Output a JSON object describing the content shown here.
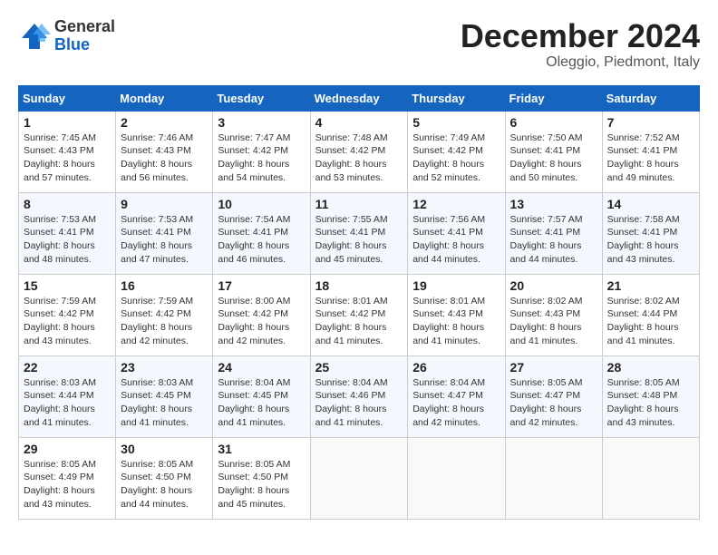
{
  "header": {
    "logo_general": "General",
    "logo_blue": "Blue",
    "title": "December 2024",
    "location": "Oleggio, Piedmont, Italy"
  },
  "days_of_week": [
    "Sunday",
    "Monday",
    "Tuesday",
    "Wednesday",
    "Thursday",
    "Friday",
    "Saturday"
  ],
  "weeks": [
    [
      {
        "day": 1,
        "info": "Sunrise: 7:45 AM\nSunset: 4:43 PM\nDaylight: 8 hours\nand 57 minutes."
      },
      {
        "day": 2,
        "info": "Sunrise: 7:46 AM\nSunset: 4:43 PM\nDaylight: 8 hours\nand 56 minutes."
      },
      {
        "day": 3,
        "info": "Sunrise: 7:47 AM\nSunset: 4:42 PM\nDaylight: 8 hours\nand 54 minutes."
      },
      {
        "day": 4,
        "info": "Sunrise: 7:48 AM\nSunset: 4:42 PM\nDaylight: 8 hours\nand 53 minutes."
      },
      {
        "day": 5,
        "info": "Sunrise: 7:49 AM\nSunset: 4:42 PM\nDaylight: 8 hours\nand 52 minutes."
      },
      {
        "day": 6,
        "info": "Sunrise: 7:50 AM\nSunset: 4:41 PM\nDaylight: 8 hours\nand 50 minutes."
      },
      {
        "day": 7,
        "info": "Sunrise: 7:52 AM\nSunset: 4:41 PM\nDaylight: 8 hours\nand 49 minutes."
      }
    ],
    [
      {
        "day": 8,
        "info": "Sunrise: 7:53 AM\nSunset: 4:41 PM\nDaylight: 8 hours\nand 48 minutes."
      },
      {
        "day": 9,
        "info": "Sunrise: 7:53 AM\nSunset: 4:41 PM\nDaylight: 8 hours\nand 47 minutes."
      },
      {
        "day": 10,
        "info": "Sunrise: 7:54 AM\nSunset: 4:41 PM\nDaylight: 8 hours\nand 46 minutes."
      },
      {
        "day": 11,
        "info": "Sunrise: 7:55 AM\nSunset: 4:41 PM\nDaylight: 8 hours\nand 45 minutes."
      },
      {
        "day": 12,
        "info": "Sunrise: 7:56 AM\nSunset: 4:41 PM\nDaylight: 8 hours\nand 44 minutes."
      },
      {
        "day": 13,
        "info": "Sunrise: 7:57 AM\nSunset: 4:41 PM\nDaylight: 8 hours\nand 44 minutes."
      },
      {
        "day": 14,
        "info": "Sunrise: 7:58 AM\nSunset: 4:41 PM\nDaylight: 8 hours\nand 43 minutes."
      }
    ],
    [
      {
        "day": 15,
        "info": "Sunrise: 7:59 AM\nSunset: 4:42 PM\nDaylight: 8 hours\nand 43 minutes."
      },
      {
        "day": 16,
        "info": "Sunrise: 7:59 AM\nSunset: 4:42 PM\nDaylight: 8 hours\nand 42 minutes."
      },
      {
        "day": 17,
        "info": "Sunrise: 8:00 AM\nSunset: 4:42 PM\nDaylight: 8 hours\nand 42 minutes."
      },
      {
        "day": 18,
        "info": "Sunrise: 8:01 AM\nSunset: 4:42 PM\nDaylight: 8 hours\nand 41 minutes."
      },
      {
        "day": 19,
        "info": "Sunrise: 8:01 AM\nSunset: 4:43 PM\nDaylight: 8 hours\nand 41 minutes."
      },
      {
        "day": 20,
        "info": "Sunrise: 8:02 AM\nSunset: 4:43 PM\nDaylight: 8 hours\nand 41 minutes."
      },
      {
        "day": 21,
        "info": "Sunrise: 8:02 AM\nSunset: 4:44 PM\nDaylight: 8 hours\nand 41 minutes."
      }
    ],
    [
      {
        "day": 22,
        "info": "Sunrise: 8:03 AM\nSunset: 4:44 PM\nDaylight: 8 hours\nand 41 minutes."
      },
      {
        "day": 23,
        "info": "Sunrise: 8:03 AM\nSunset: 4:45 PM\nDaylight: 8 hours\nand 41 minutes."
      },
      {
        "day": 24,
        "info": "Sunrise: 8:04 AM\nSunset: 4:45 PM\nDaylight: 8 hours\nand 41 minutes."
      },
      {
        "day": 25,
        "info": "Sunrise: 8:04 AM\nSunset: 4:46 PM\nDaylight: 8 hours\nand 41 minutes."
      },
      {
        "day": 26,
        "info": "Sunrise: 8:04 AM\nSunset: 4:47 PM\nDaylight: 8 hours\nand 42 minutes."
      },
      {
        "day": 27,
        "info": "Sunrise: 8:05 AM\nSunset: 4:47 PM\nDaylight: 8 hours\nand 42 minutes."
      },
      {
        "day": 28,
        "info": "Sunrise: 8:05 AM\nSunset: 4:48 PM\nDaylight: 8 hours\nand 43 minutes."
      }
    ],
    [
      {
        "day": 29,
        "info": "Sunrise: 8:05 AM\nSunset: 4:49 PM\nDaylight: 8 hours\nand 43 minutes."
      },
      {
        "day": 30,
        "info": "Sunrise: 8:05 AM\nSunset: 4:50 PM\nDaylight: 8 hours\nand 44 minutes."
      },
      {
        "day": 31,
        "info": "Sunrise: 8:05 AM\nSunset: 4:50 PM\nDaylight: 8 hours\nand 45 minutes."
      },
      null,
      null,
      null,
      null
    ]
  ]
}
